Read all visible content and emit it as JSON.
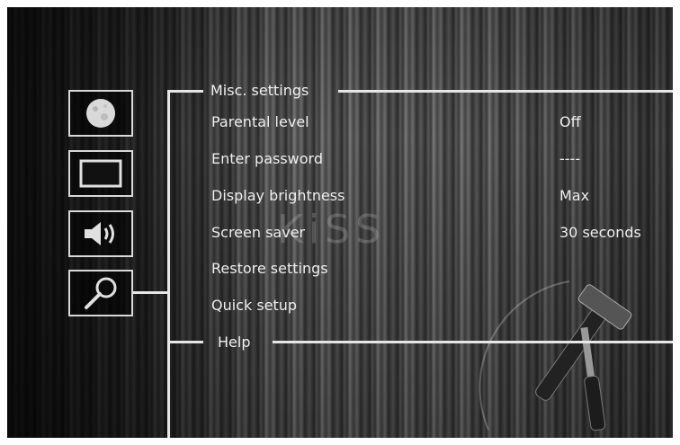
{
  "sections": {
    "misc": "Misc. settings",
    "help": "Help"
  },
  "menu": [
    {
      "label": "Parental level",
      "value": "Off"
    },
    {
      "label": "Enter password",
      "value": "----"
    },
    {
      "label": "Display brightness",
      "value": "Max"
    },
    {
      "label": "Screen saver",
      "value": "30 seconds"
    },
    {
      "label": "Restore settings",
      "value": ""
    },
    {
      "label": "Quick setup",
      "value": ""
    }
  ],
  "sidebar": [
    {
      "icon": "moon-icon"
    },
    {
      "icon": "display-icon"
    },
    {
      "icon": "speaker-icon"
    },
    {
      "icon": "magnifier-icon",
      "selected": true
    }
  ],
  "watermark": "KiSS",
  "colors": {
    "text": "#eeeeee",
    "line": "#e6e6e6"
  }
}
